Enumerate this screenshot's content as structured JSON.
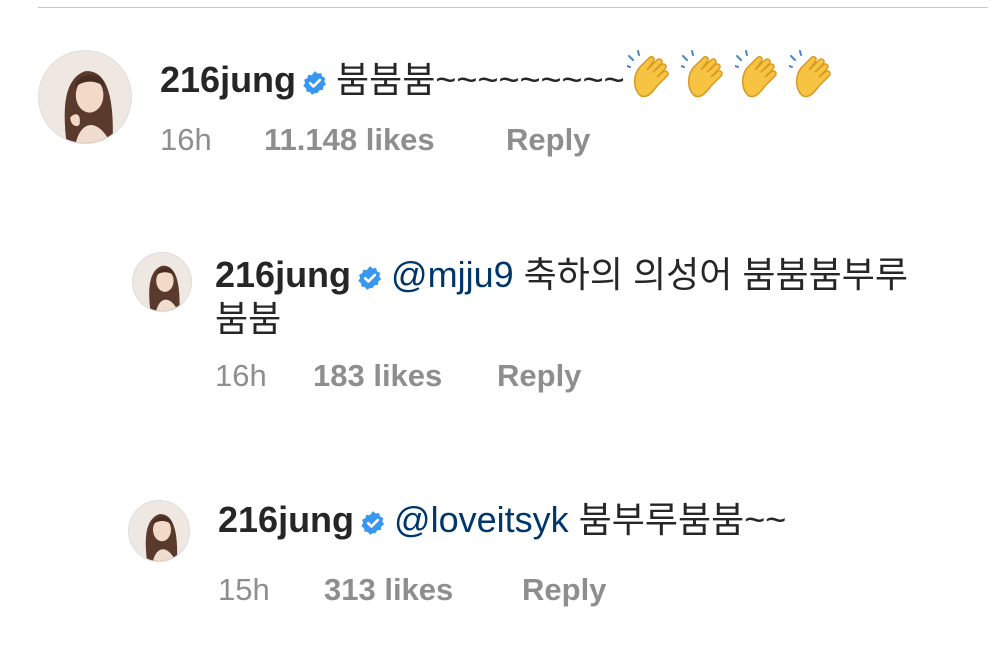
{
  "comments": [
    {
      "username": "216jung",
      "mention": "",
      "text": "붐붐붐~~~~~~~~~",
      "emoji": [
        "clapping-hands",
        "clapping-hands",
        "clapping-hands",
        "clapping-hands"
      ],
      "time": "16h",
      "likes": "11.148 likes",
      "reply": "Reply"
    },
    {
      "username": "216jung",
      "mention": "@mjju9",
      "text_line1": "축하의 의성어 붐붐붐부루",
      "text_line2": "붐붐",
      "time": "16h",
      "likes": "183 likes",
      "reply": "Reply"
    },
    {
      "username": "216jung",
      "mention": "@loveitsyk",
      "text": "붐부루붐붐~~",
      "time": "15h",
      "likes": "313 likes",
      "reply": "Reply"
    }
  ],
  "colors": {
    "verified_blue": "#3897f0",
    "mention_blue": "#00376b",
    "meta_gray": "#8e8e8e"
  }
}
